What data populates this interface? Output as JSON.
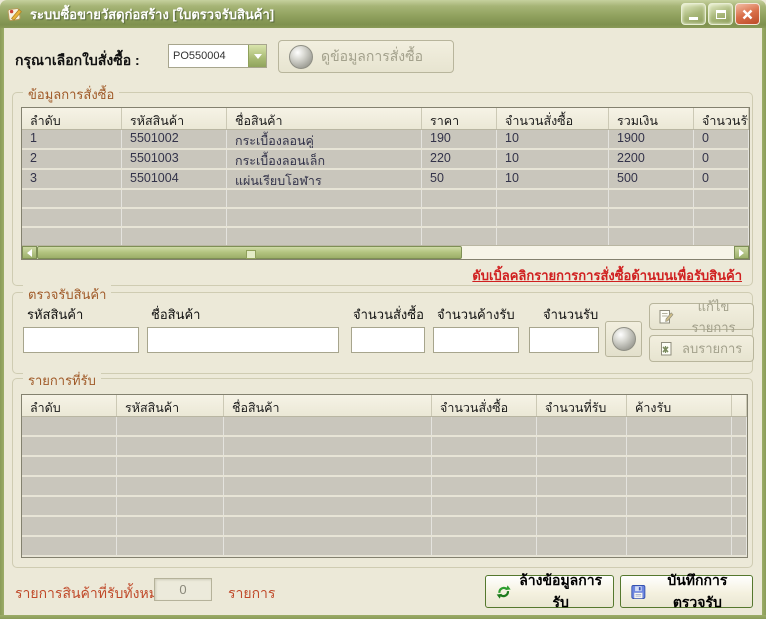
{
  "window": {
    "title": "ระบบซื้อขายวัสดุก่อสร้าง [ใบตรวจรับสินค้า]"
  },
  "po_selector": {
    "label": "กรุณาเลือกใบสั่งซื้อ :",
    "value": "PO550004",
    "view_button_label": "ดูข้อมูลการสั่งซื้อ"
  },
  "order_section": {
    "title": "ข้อมูลการสั่งซื้อ",
    "columns": [
      "ลำดับ",
      "รหัสสินค้า",
      "ชื่อสินค้า",
      "ราคา",
      "จำนวนสั่งซื้อ",
      "รวมเงิน",
      "จำนวนรับ"
    ],
    "rows": [
      {
        "no": "1",
        "code": "5501002",
        "name": "กระเบื้องลอนคู่",
        "price": "190",
        "qty": "10",
        "total": "1900",
        "received": "0"
      },
      {
        "no": "2",
        "code": "5501003",
        "name": "กระเบื้องลอนเล็ก",
        "price": "220",
        "qty": "10",
        "total": "2200",
        "received": "0"
      },
      {
        "no": "3",
        "code": "5501004",
        "name": "แผ่นเรียบโอฬาร",
        "price": "50",
        "qty": "10",
        "total": "500",
        "received": "0"
      }
    ],
    "hint_link": "ดับเบิ้ลคลิกรายการการสั่งซื้อด้านบนเพื่อรับสินค้า"
  },
  "receive_section": {
    "title": "ตรวจรับสินค้า",
    "labels": {
      "code": "รหัสสินค้า",
      "name": "ชื่อสินค้า",
      "order_qty": "จำนวนสั่งซื้อ",
      "pending_qty": "จำนวนค้างรับ",
      "receive_qty": "จำนวนรับ"
    },
    "values": {
      "code": "",
      "name": "",
      "order_qty": "",
      "pending_qty": "",
      "receive_qty": ""
    },
    "edit_button_label": "แก้ไขรายการ",
    "delete_button_label": "ลบรายการ"
  },
  "received_section": {
    "title": "รายการที่รับ",
    "columns": [
      "ลำดับ",
      "รหัสสินค้า",
      "ชื่อสินค้า",
      "จำนวนสั่งซื้อ",
      "จำนวนที่รับ",
      "ค้างรับ"
    ],
    "rows": []
  },
  "footer": {
    "summary_label": "รายการสินค้าที่รับทั้งหมด",
    "summary_count": "0",
    "summary_unit": "รายการ",
    "clear_button_label": "ล้างข้อมูลการรับ",
    "save_button_label": "บันทึกการตรวจรับ"
  },
  "icons": {
    "app": "note-pencil-icon",
    "view_order": "sphere-magnifier-icon",
    "receive_lookup": "sphere-magnifier-icon",
    "combo_arrow": "chevron-down-icon",
    "edit": "edit-page-icon",
    "delete": "delete-page-icon",
    "clear": "refresh-arrows-icon",
    "save": "floppy-disk-icon"
  },
  "colors": {
    "titlebar_green": "#91a25f",
    "form_background": "#ece9d8",
    "group_label_brown": "#a05a28",
    "row_gray": "#c9c6bc",
    "link_red": "#d02020",
    "footer_text_red": "#c04a2a",
    "button_border_green": "#55782e",
    "close_button_red": "#bc4a28"
  }
}
